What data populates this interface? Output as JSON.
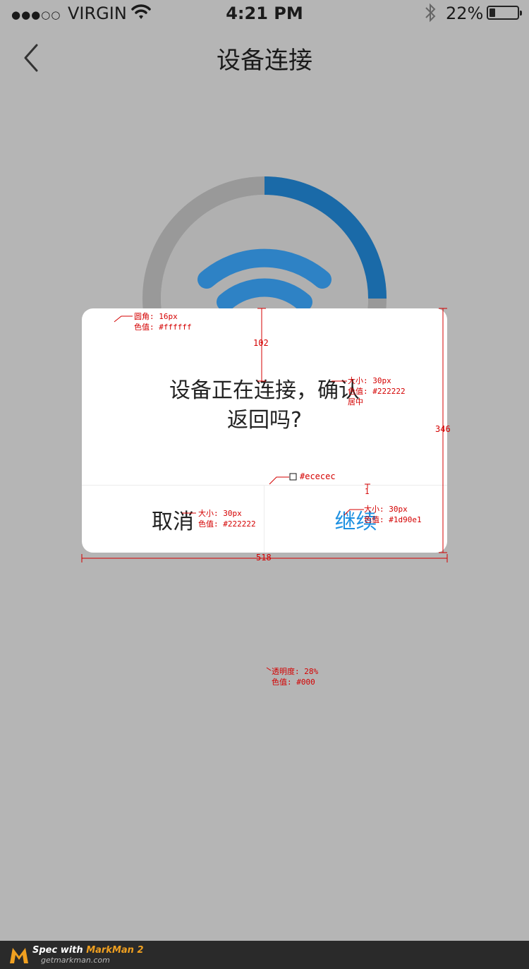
{
  "status_bar": {
    "signal": "●●●○○",
    "carrier": "VIRGIN",
    "time": "4:21 PM",
    "battery_percent": "22%",
    "battery_level": 0.22
  },
  "nav": {
    "title": "设备连接",
    "back_icon": "chevron-left-icon"
  },
  "progress": {
    "value": 0.25,
    "track_color": "#999999",
    "fill_color": "#1a6aa8",
    "icon": "wifi-icon",
    "icon_color": "#2e82c5"
  },
  "dialog": {
    "message_line1": "设备正在连接，确认",
    "message_line2": "返回吗?",
    "cancel_label": "取消",
    "continue_label": "继续",
    "continue_color": "#1d90e1",
    "text_color": "#222222",
    "divider_color": "#ececec",
    "background": "#ffffff"
  },
  "overlay": {
    "color": "#000",
    "opacity": 0.28
  },
  "annotations": {
    "radius_label": "圆角: 16px",
    "radius_color": "色值: #ffffff",
    "top_spacing": "102",
    "msg_size": "大小: 30px",
    "msg_color": "色值: #222222",
    "msg_align": "居中",
    "height": "346",
    "divider_swatch": "#ececec",
    "divider_width": "1",
    "cancel_size": "大小: 30px",
    "cancel_color": "色值: #222222",
    "continue_size": "大小: 30px",
    "continue_color": "色值: #1d90e1",
    "width": "518",
    "overlay_opacity": "透明度: 28%",
    "overlay_color": "色值: #000"
  },
  "footer": {
    "spec_prefix": "Spec with ",
    "spec_brand": "MarkMan 2",
    "url": "getmarkman.com"
  }
}
